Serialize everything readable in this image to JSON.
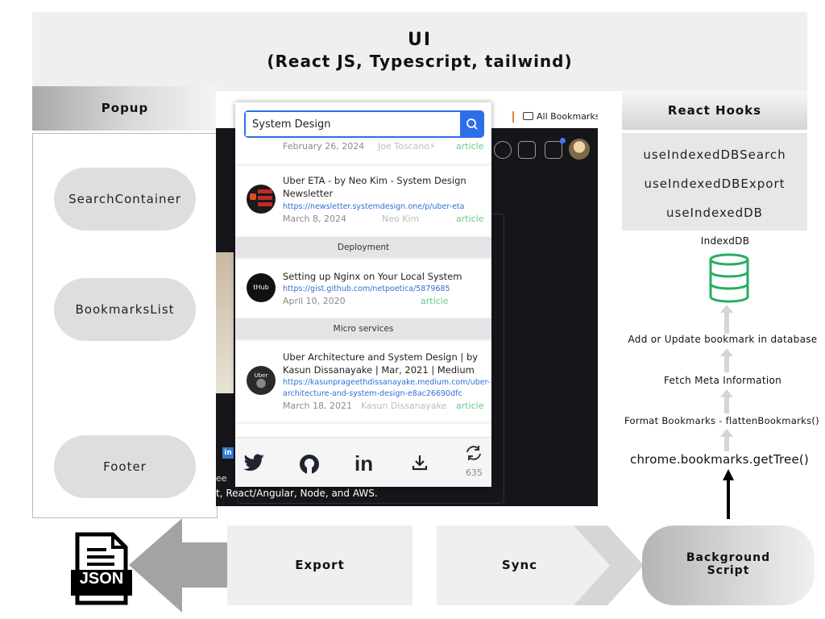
{
  "ui_banner": {
    "line1": "UI",
    "line2": "(React JS, Typescript, tailwind)"
  },
  "popup_column": {
    "title": "Popup",
    "components": [
      "SearchContainer",
      "BookmarksList",
      "Footer"
    ]
  },
  "hooks_column": {
    "title": "React Hooks",
    "hooks": [
      "useIndexedDBSearch",
      "useIndexedDBExport",
      "useIndexedDB"
    ]
  },
  "database": {
    "label": "IndexdDB"
  },
  "pipeline_steps": [
    "Add or Update bookmark in database",
    "Fetch Meta Information",
    "Format Bookmarks - flattenBookmarks()",
    "chrome.bookmarks.getTree()"
  ],
  "bottom_flow": {
    "export_label": "Export",
    "sync_label": "Sync",
    "background_line1": "Background",
    "background_line2": "Script",
    "json_label": "JSON"
  },
  "screenshot": {
    "all_bookmarks": "All Bookmarks",
    "bottom_text": "t, React/Angular, Node, and AWS.",
    "ee_text": "ee",
    "search": {
      "value": "System Design"
    },
    "partial_card": {
      "date": "February 26, 2024",
      "author": "Joe Toscano⚡",
      "type": "article"
    },
    "cards": [
      {
        "title_line1": "Uber ETA - by Neo Kim - System Design",
        "title_line2": "Newsletter",
        "url_line1": "https://newsletter.systemdesign.one/p/uber-eta",
        "url_line2": "",
        "date": "March 8, 2024",
        "author": "Neo Kim",
        "type": "article"
      },
      {
        "title_line1": "Setting up Nginx on Your Local System",
        "title_line2": "",
        "url_line1": "https://gist.github.com/netpoetica/5879685",
        "url_line2": "",
        "date": "April 10, 2020",
        "author": "",
        "type": "article"
      },
      {
        "title_line1": "Uber Architecture and System Design | by",
        "title_line2": "Kasun Dissanayake | Mar, 2021 | Medium",
        "url_line1": "https://kasunprageethdissanayake.medium.com/uber-",
        "url_line2": "architecture-and-system-design-e8ac26690dfc",
        "date": "March 18, 2021",
        "author": "Kasun Dissanayake",
        "type": "article"
      }
    ],
    "groups": [
      "Deployment",
      "Micro services"
    ],
    "avatar_texts": [
      "tHub Gist",
      "Uber"
    ],
    "footer": {
      "icons": [
        "twitter-icon",
        "github-icon",
        "linkedin-icon",
        "download-icon",
        "sync-icon"
      ],
      "count": "635"
    }
  }
}
